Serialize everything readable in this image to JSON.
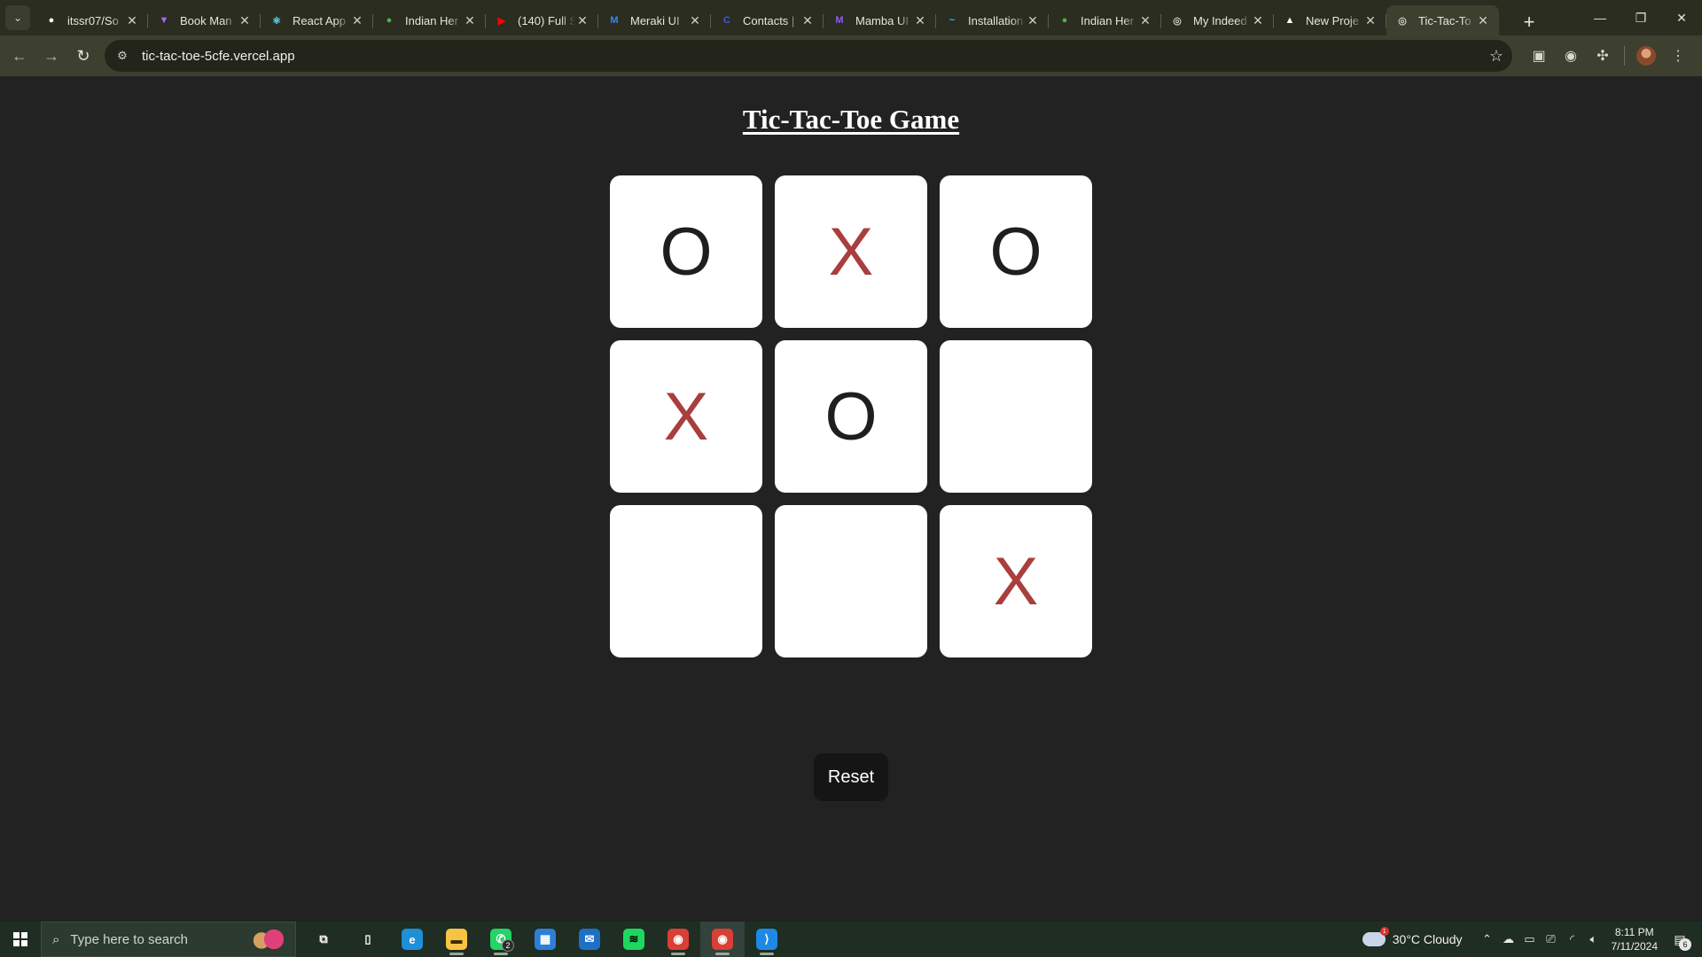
{
  "browser": {
    "tabs": [
      {
        "title": "itssr07/So",
        "favicon": "github-icon",
        "favicon_color": "#ffffff",
        "glyph": "●"
      },
      {
        "title": "Book Man",
        "favicon": "vite-icon",
        "favicon_color": "#a26bff",
        "glyph": "▼"
      },
      {
        "title": "React App",
        "favicon": "react-icon",
        "favicon_color": "#61dafb",
        "glyph": "⚛"
      },
      {
        "title": "Indian Her",
        "favicon": "globe-icon",
        "favicon_color": "#4caf50",
        "glyph": "●"
      },
      {
        "title": "(140) Full S",
        "favicon": "youtube-icon",
        "favicon_color": "#ff0000",
        "glyph": "▶"
      },
      {
        "title": "Meraki UI",
        "favicon": "meraki-icon",
        "favicon_color": "#3b82f6",
        "glyph": "M"
      },
      {
        "title": "Contacts |",
        "favicon": "contacts-icon",
        "favicon_color": "#3b5bdb",
        "glyph": "C"
      },
      {
        "title": "Mamba UI",
        "favicon": "mamba-icon",
        "favicon_color": "#8b5cf6",
        "glyph": "M"
      },
      {
        "title": "Installation",
        "favicon": "tailwind-icon",
        "favicon_color": "#38bdf8",
        "glyph": "~"
      },
      {
        "title": "Indian Her",
        "favicon": "globe-icon",
        "favicon_color": "#4caf50",
        "glyph": "●"
      },
      {
        "title": "My Indeed",
        "favicon": "globe-icon",
        "favicon_color": "#cfcfc6",
        "glyph": "◎"
      },
      {
        "title": "New Proje",
        "favicon": "vercel-icon",
        "favicon_color": "#ffffff",
        "glyph": "▲"
      },
      {
        "title": "Tic-Tac-To",
        "favicon": "globe-icon",
        "favicon_color": "#cfcfc6",
        "glyph": "◎",
        "active": true
      }
    ],
    "url": "tic-tac-toe-5cfe.vercel.app"
  },
  "game": {
    "title": "Tic-Tac-Toe Game",
    "board": [
      "O",
      "X",
      "O",
      "X",
      "O",
      "",
      "",
      "",
      "X"
    ],
    "x_color": "#a93e3e",
    "o_color": "#1e1e1e",
    "reset_label": "Reset"
  },
  "taskbar": {
    "search_placeholder": "Type here to search",
    "apps": [
      {
        "name": "task-view-icon",
        "glyph": "⧉",
        "color": "#ffffff",
        "bg": "transparent"
      },
      {
        "name": "file-icon",
        "glyph": "▯",
        "color": "#ffffff",
        "bg": "transparent"
      },
      {
        "name": "edge-icon",
        "glyph": "e",
        "color": "#ffffff",
        "bg": "#1f8fd8"
      },
      {
        "name": "file-explorer-icon",
        "glyph": "▬",
        "color": "#3a2b00",
        "bg": "#f6c344",
        "running": true
      },
      {
        "name": "whatsapp-icon",
        "glyph": "✆",
        "color": "#ffffff",
        "bg": "#25d366",
        "running": true,
        "badge": "2"
      },
      {
        "name": "microsoft-store-icon",
        "glyph": "▦",
        "color": "#ffffff",
        "bg": "#2d7fd6"
      },
      {
        "name": "mail-icon",
        "glyph": "✉",
        "color": "#ffffff",
        "bg": "#1f6fc5"
      },
      {
        "name": "spotify-icon",
        "glyph": "≋",
        "color": "#000000",
        "bg": "#1ed760"
      },
      {
        "name": "chrome-profile-icon",
        "glyph": "◉",
        "color": "#ffffff",
        "bg": "#d93f35",
        "running": true
      },
      {
        "name": "chrome-icon",
        "glyph": "◉",
        "color": "#ffffff",
        "bg": "#d93f35",
        "running": true,
        "active": true
      },
      {
        "name": "vscode-icon",
        "glyph": "⟩",
        "color": "#ffffff",
        "bg": "#1e88e5",
        "running": true
      }
    ],
    "weather": "30°C  Cloudy",
    "weather_alert": "1",
    "time": "8:11 PM",
    "date": "7/11/2024",
    "notifications": "6"
  }
}
